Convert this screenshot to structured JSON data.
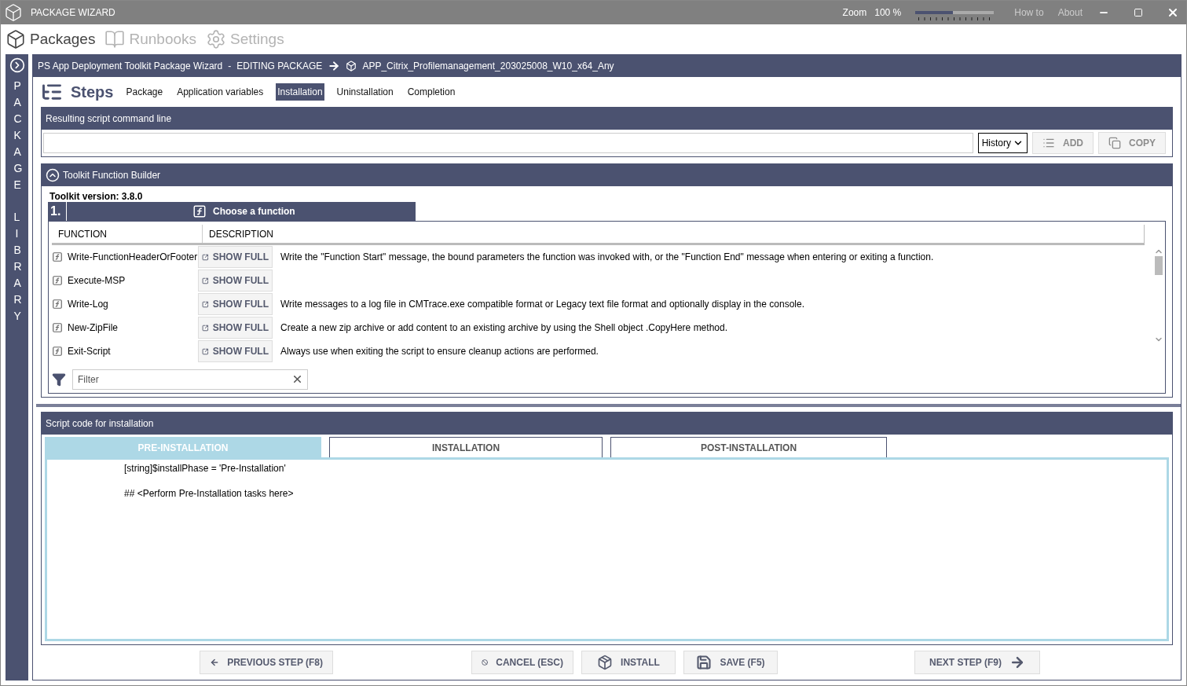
{
  "window": {
    "title": "PACKAGE WIZARD",
    "zoom_label": "Zoom",
    "zoom_value": "100 %",
    "zoom": {
      "level": 0.48
    },
    "links": [
      "How to",
      "About"
    ]
  },
  "nav": [
    {
      "label": "Packages",
      "kind": "package",
      "selected": true
    },
    {
      "label": "Runbooks",
      "kind": "book",
      "selected": false
    },
    {
      "label": "Settings",
      "kind": "gear",
      "selected": false
    }
  ],
  "sidebar": {
    "words": [
      "PACKAGE",
      "LIBRARY"
    ]
  },
  "header": {
    "title": "PS App Deployment Toolkit Package Wizard",
    "separator": "-",
    "mode": "EDITING PACKAGE",
    "package": "APP_Citrix_Profilemanagement_203025008_W10_x64_Any"
  },
  "steps": {
    "title": "Steps",
    "tabs": [
      {
        "label": "Package",
        "selected": false
      },
      {
        "label": "Application variables",
        "selected": false
      },
      {
        "label": "Installation",
        "selected": true
      },
      {
        "label": "Uninstallation",
        "selected": false
      },
      {
        "label": "Completion",
        "selected": false
      }
    ]
  },
  "command_line": {
    "title": "Resulting script command line",
    "history": "History",
    "buttons": [
      {
        "label": "ADD",
        "kind": "add",
        "disabled": true
      },
      {
        "label": "COPY",
        "kind": "copy",
        "disabled": true
      }
    ]
  },
  "function_builder": {
    "title": "Toolkit Function Builder",
    "expanded": true,
    "version_label": "Toolkit version:",
    "version": "3.8.0",
    "step_number": "1.",
    "step_title": "Choose a function",
    "columns": [
      "FUNCTION",
      "DESCRIPTION"
    ],
    "rows": [
      {
        "name": "Write-FunctionHeaderOrFooter",
        "action": "SHOW FULL",
        "description": "Write the \"Function Start\" message, the bound parameters the function was invoked with, or the \"Function End\" message when entering or exiting a function."
      },
      {
        "name": "Execute-MSP",
        "action": "SHOW FULL"
      },
      {
        "name": "Write-Log",
        "action": "SHOW FULL",
        "description": "Write messages to a log file in CMTrace.exe compatible format or Legacy text file format and optionally display in the console."
      },
      {
        "name": "New-ZipFile",
        "action": "SHOW FULL",
        "description": "Create a new zip archive or add content to an existing archive by using the Shell object .CopyHere method."
      },
      {
        "name": "Exit-Script",
        "action": "SHOW FULL",
        "description": "Always use when exiting the script to ensure cleanup actions are performed."
      }
    ],
    "filter": {
      "placeholder": "Filter"
    }
  },
  "script": {
    "title": "Script code for installation",
    "tabs": [
      {
        "label": "PRE-INSTALLATION",
        "selected": true
      },
      {
        "label": "INSTALLATION",
        "selected": false
      },
      {
        "label": "POST-INSTALLATION",
        "selected": false
      }
    ],
    "lines": [
      "[string]$installPhase = 'Pre-Installation'",
      "## <Perform Pre-Installation tasks here>"
    ]
  },
  "footer": [
    {
      "label": "PREVIOUS STEP (F8)",
      "kind": "back"
    },
    {
      "label": "CANCEL (ESC)",
      "kind": "cancel"
    },
    {
      "label": "INSTALL",
      "kind": "install"
    },
    {
      "label": "SAVE (F5)",
      "kind": "save"
    },
    {
      "label": "NEXT STEP (F9)",
      "kind": "next"
    }
  ]
}
